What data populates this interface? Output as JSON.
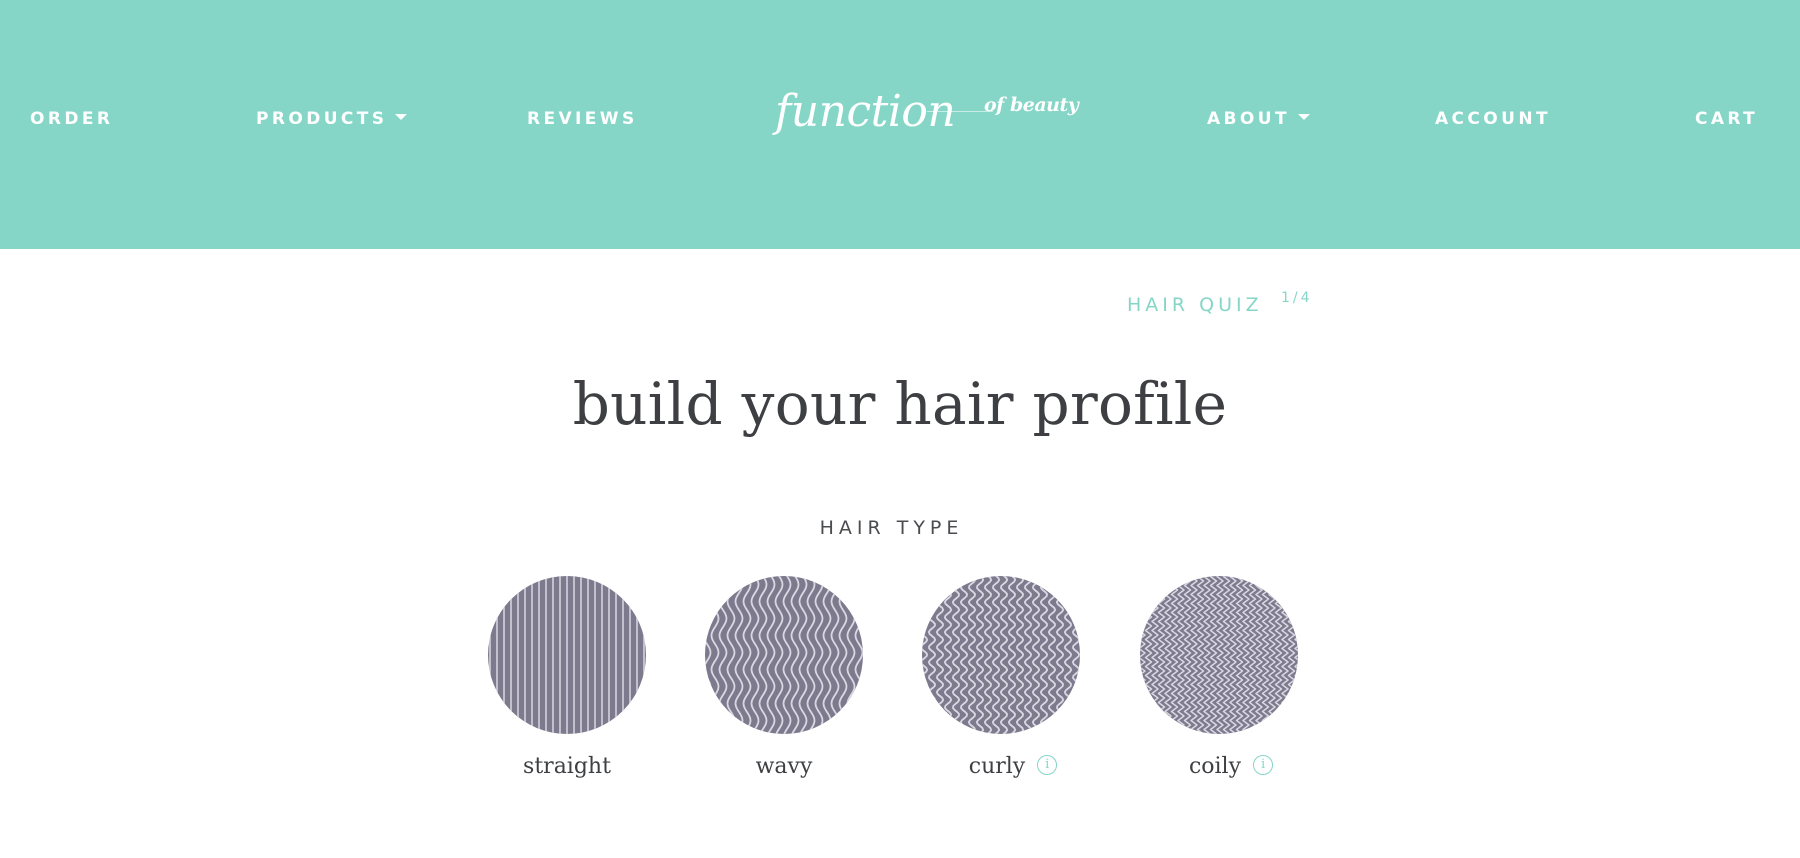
{
  "colors": {
    "brand": "#86d6c8",
    "swatch": "#7d7a8e",
    "swatch_line": "#d9d8e2",
    "title_text": "#3d3f42"
  },
  "nav": {
    "left": [
      {
        "label": "ORDER"
      },
      {
        "label": "PRODUCTS",
        "has_dropdown": true
      },
      {
        "label": "REVIEWS"
      }
    ],
    "right": [
      {
        "label": "ABOUT",
        "has_dropdown": true
      },
      {
        "label": "ACCOUNT"
      },
      {
        "label": "CART"
      }
    ]
  },
  "logo": {
    "main": "function",
    "sub": "of beauty"
  },
  "quiz": {
    "label": "HAIR QUIZ",
    "step": "1/4"
  },
  "page": {
    "title": "build your hair profile",
    "section_label": "HAIR TYPE"
  },
  "hair_types": [
    {
      "label": "straight",
      "pattern": "straight-lines",
      "has_info": false
    },
    {
      "label": "wavy",
      "pattern": "gentle-waves",
      "has_info": false
    },
    {
      "label": "curly",
      "pattern": "tight-waves",
      "has_info": true,
      "info_glyph": "i"
    },
    {
      "label": "coily",
      "pattern": "zigzag",
      "has_info": true,
      "info_glyph": "i"
    }
  ]
}
